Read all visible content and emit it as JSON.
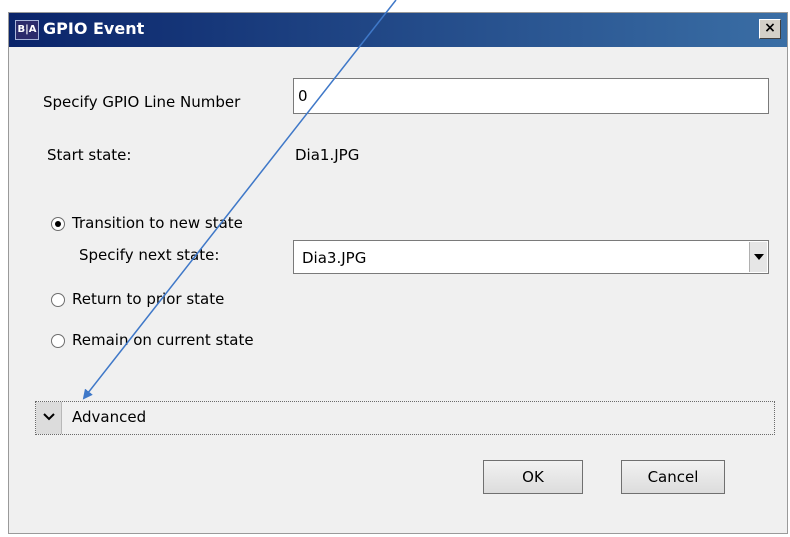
{
  "window": {
    "title": "GPIO Event",
    "app_icon_text": "B|A",
    "close_glyph": "×"
  },
  "line_number": {
    "label": "Specify GPIO Line Number",
    "value": "0"
  },
  "start_state": {
    "label": "Start state:",
    "value": "Dia1.JPG"
  },
  "options": {
    "transition": {
      "label": "Transition to new state",
      "checked": true
    },
    "next_state": {
      "label": "Specify next state:",
      "selected": "Dia3.JPG"
    },
    "return_prior": {
      "label": "Return to prior state",
      "checked": false
    },
    "remain_current": {
      "label": "Remain on current state",
      "checked": false
    }
  },
  "advanced": {
    "label": "Advanced"
  },
  "buttons": {
    "ok": "OK",
    "cancel": "Cancel"
  },
  "colors": {
    "arrow": "#3f78c8",
    "title_bar": "#0a246a"
  }
}
